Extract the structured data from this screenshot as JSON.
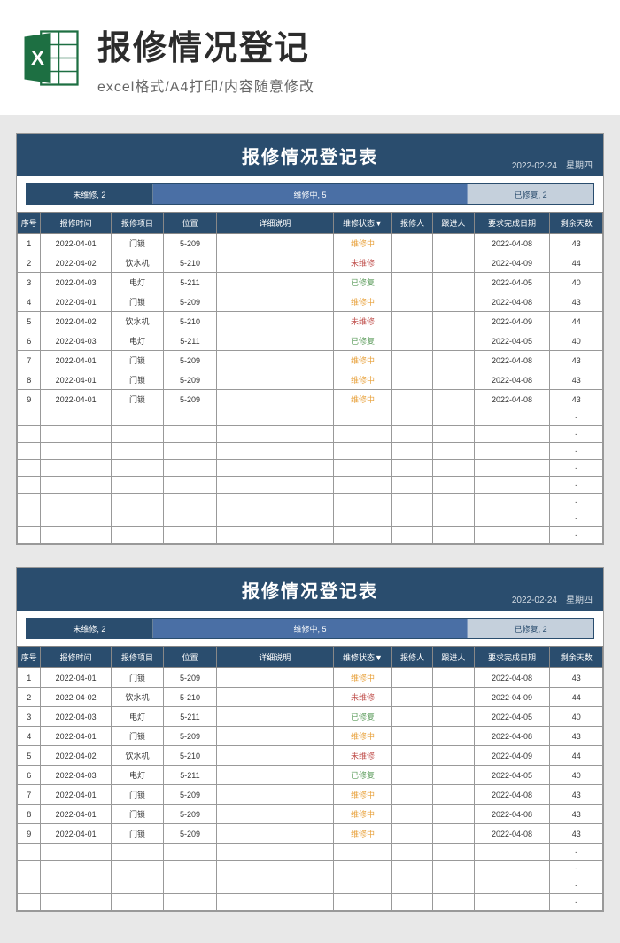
{
  "banner": {
    "title": "报修情况登记",
    "subtitle": "excel格式/A4打印/内容随意修改"
  },
  "sheet": {
    "title": "报修情况登记表",
    "dateInfo": "2022-02-24　星期四",
    "segments": {
      "s1": "未维修, 2",
      "s2": "维修中, 5",
      "s3": "已修复, 2"
    },
    "headers": {
      "seq": "序号",
      "time": "报修时间",
      "item": "报修项目",
      "loc": "位置",
      "desc": "详细说明",
      "status": "维修状态▼",
      "person": "报修人",
      "follow": "跟进人",
      "reqDate": "要求完成日期",
      "days": "剩余天数"
    },
    "rows": [
      {
        "seq": "1",
        "time": "2022-04-01",
        "item": "门锁",
        "loc": "5-209",
        "desc": "",
        "status": "维修中",
        "statusCls": "st-orange",
        "person": "",
        "follow": "",
        "req": "2022-04-08",
        "days": "43"
      },
      {
        "seq": "2",
        "time": "2022-04-02",
        "item": "饮水机",
        "loc": "5-210",
        "desc": "",
        "status": "未维修",
        "statusCls": "st-red",
        "person": "",
        "follow": "",
        "req": "2022-04-09",
        "days": "44"
      },
      {
        "seq": "3",
        "time": "2022-04-03",
        "item": "电灯",
        "loc": "5-211",
        "desc": "",
        "status": "已修复",
        "statusCls": "st-green",
        "person": "",
        "follow": "",
        "req": "2022-04-05",
        "days": "40"
      },
      {
        "seq": "4",
        "time": "2022-04-01",
        "item": "门锁",
        "loc": "5-209",
        "desc": "",
        "status": "维修中",
        "statusCls": "st-orange",
        "person": "",
        "follow": "",
        "req": "2022-04-08",
        "days": "43"
      },
      {
        "seq": "5",
        "time": "2022-04-02",
        "item": "饮水机",
        "loc": "5-210",
        "desc": "",
        "status": "未维修",
        "statusCls": "st-red",
        "person": "",
        "follow": "",
        "req": "2022-04-09",
        "days": "44"
      },
      {
        "seq": "6",
        "time": "2022-04-03",
        "item": "电灯",
        "loc": "5-211",
        "desc": "",
        "status": "已修复",
        "statusCls": "st-green",
        "person": "",
        "follow": "",
        "req": "2022-04-05",
        "days": "40"
      },
      {
        "seq": "7",
        "time": "2022-04-01",
        "item": "门锁",
        "loc": "5-209",
        "desc": "",
        "status": "维修中",
        "statusCls": "st-orange",
        "person": "",
        "follow": "",
        "req": "2022-04-08",
        "days": "43"
      },
      {
        "seq": "8",
        "time": "2022-04-01",
        "item": "门锁",
        "loc": "5-209",
        "desc": "",
        "status": "维修中",
        "statusCls": "st-orange",
        "person": "",
        "follow": "",
        "req": "2022-04-08",
        "days": "43"
      },
      {
        "seq": "9",
        "time": "2022-04-01",
        "item": "门锁",
        "loc": "5-209",
        "desc": "",
        "status": "维修中",
        "statusCls": "st-orange",
        "person": "",
        "follow": "",
        "req": "2022-04-08",
        "days": "43"
      }
    ],
    "emptyRowsTop": 8,
    "emptyRowsBottom": 4,
    "dash": "-"
  }
}
